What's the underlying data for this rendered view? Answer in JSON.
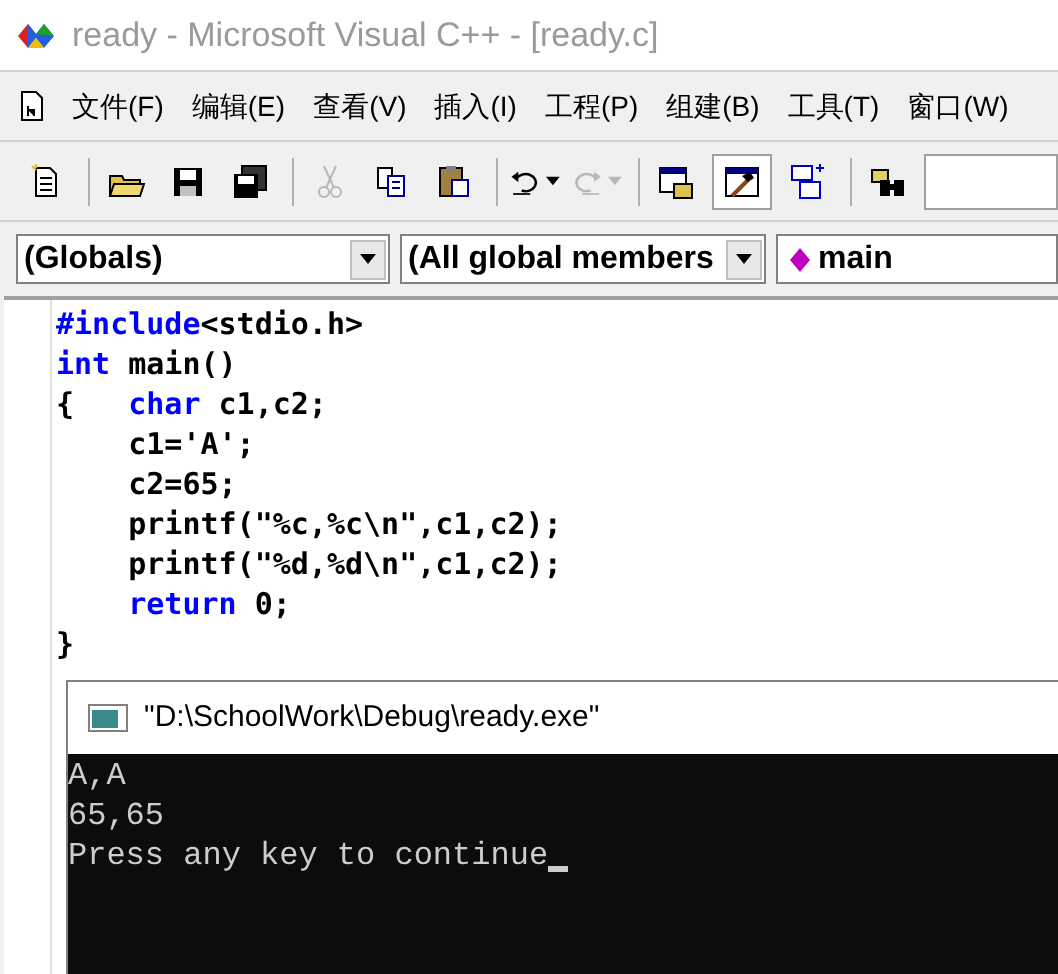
{
  "window": {
    "title": "ready - Microsoft Visual C++ - [ready.c]"
  },
  "menu": [
    "文件(F)",
    "编辑(E)",
    "查看(V)",
    "插入(I)",
    "工程(P)",
    "组建(B)",
    "工具(T)",
    "窗口(W)"
  ],
  "toolbar": [
    {
      "kind": "new",
      "disabled": false,
      "selected": false
    },
    {
      "kind": "open",
      "disabled": false,
      "selected": false
    },
    {
      "kind": "save",
      "disabled": false,
      "selected": false
    },
    {
      "kind": "save-all",
      "disabled": false,
      "selected": false
    },
    {
      "kind": "cut",
      "disabled": true,
      "selected": false
    },
    {
      "kind": "copy",
      "disabled": false,
      "selected": false
    },
    {
      "kind": "paste",
      "disabled": false,
      "selected": false
    },
    {
      "kind": "undo",
      "disabled": false,
      "selected": false
    },
    {
      "kind": "redo",
      "disabled": true,
      "selected": false
    },
    {
      "kind": "workspace",
      "disabled": false,
      "selected": false
    },
    {
      "kind": "build",
      "disabled": false,
      "selected": true
    },
    {
      "kind": "windows",
      "disabled": false,
      "selected": false
    },
    {
      "kind": "find",
      "disabled": false,
      "selected": false
    }
  ],
  "combos": [
    {
      "value": "(Globals)"
    },
    {
      "value": "(All global members"
    },
    {
      "value": "main"
    }
  ],
  "code": [
    {
      "indented": false,
      "segments": [
        {
          "kind": "keyword",
          "text": "#include"
        },
        {
          "kind": "plain",
          "text": "<stdio.h>"
        }
      ]
    },
    {
      "indented": false,
      "segments": [
        {
          "kind": "keyword",
          "text": "int"
        },
        {
          "kind": "plain",
          "text": " main()"
        }
      ]
    },
    {
      "indented": false,
      "segments": [
        {
          "kind": "brace",
          "text": "{"
        },
        {
          "kind": "keyword",
          "text": "char"
        },
        {
          "kind": "plain",
          "text": " c1,c2;"
        }
      ]
    },
    {
      "indented": true,
      "segments": [
        {
          "kind": "plain",
          "text": "c1='A';"
        }
      ]
    },
    {
      "indented": true,
      "segments": [
        {
          "kind": "plain",
          "text": "c2=65;"
        }
      ]
    },
    {
      "indented": true,
      "segments": [
        {
          "kind": "plain",
          "text": "printf(\"%c,%c\\n\",c1,c2);"
        }
      ]
    },
    {
      "indented": true,
      "segments": [
        {
          "kind": "plain",
          "text": "printf(\"%d,%d\\n\",c1,c2);"
        }
      ]
    },
    {
      "indented": true,
      "segments": [
        {
          "kind": "keyword",
          "text": "return"
        },
        {
          "kind": "plain",
          "text": " 0;"
        }
      ]
    },
    {
      "indented": false,
      "segments": [
        {
          "kind": "plain",
          "text": "}"
        }
      ]
    }
  ],
  "console": {
    "title": "\"D:\\SchoolWork\\Debug\\ready.exe\"",
    "lines": [
      "A,A",
      "65,65",
      "Press any key to continue"
    ]
  }
}
